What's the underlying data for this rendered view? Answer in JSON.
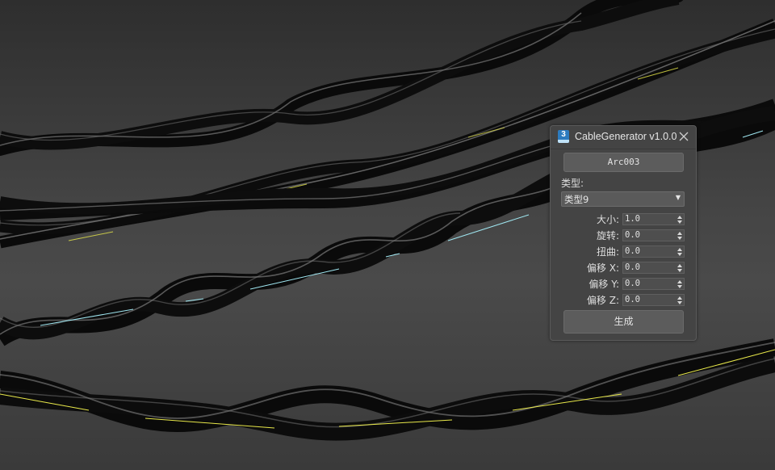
{
  "window": {
    "title": "CableGenerator v1.0.0",
    "app_icon_text": "3",
    "app_icon_name": "3dsmax-app-icon",
    "close_icon_name": "close-icon"
  },
  "object_button_label": "Arc003",
  "type": {
    "label": "类型:",
    "selected": "类型9"
  },
  "params": [
    {
      "label": "大小:",
      "value": "1.0"
    },
    {
      "label": "旋转:",
      "value": "0.0"
    },
    {
      "label": "扭曲:",
      "value": "0.0"
    },
    {
      "label": "偏移 X:",
      "value": "0.0"
    },
    {
      "label": "偏移 Y:",
      "value": "0.0"
    },
    {
      "label": "偏移 Z:",
      "value": "0.0"
    }
  ],
  "generate_button_label": "生成",
  "colors": {
    "panel_bg": "#444444",
    "cable": "#0a0a0a",
    "cable_highlight": "#8a8a8a",
    "spline_yellow": "#e8e84a",
    "spline_cyan": "#9fe6f0"
  }
}
